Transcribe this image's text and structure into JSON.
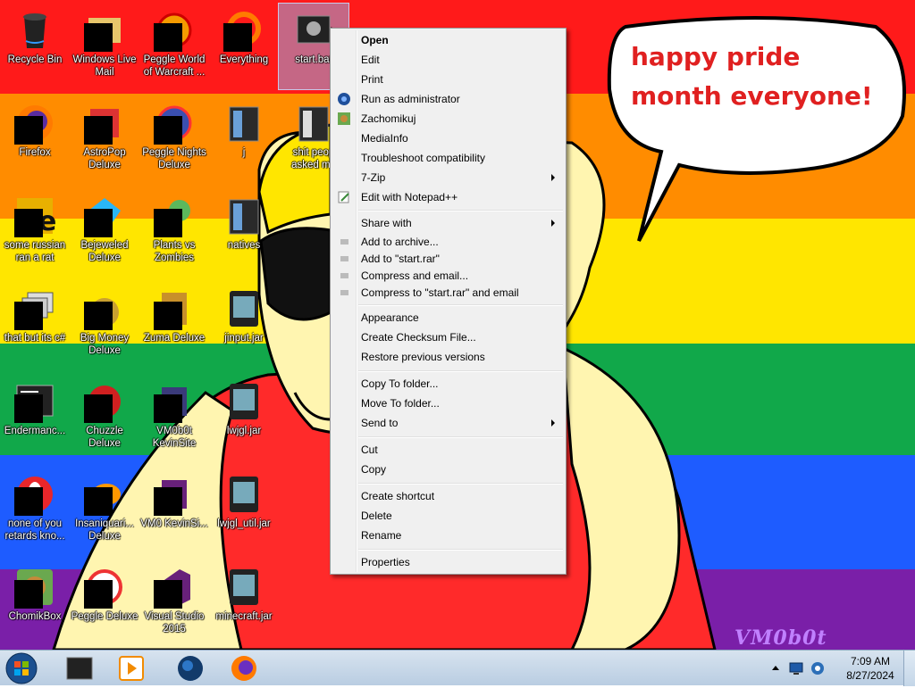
{
  "desktop": {
    "icons": [
      {
        "label": "Recycle Bin"
      },
      {
        "label": "Windows Live Mail"
      },
      {
        "label": "Peggle World of Warcraft ..."
      },
      {
        "label": "Everything"
      },
      {
        "label": "start.bat"
      },
      {
        "label": "Firefox"
      },
      {
        "label": "AstroPop Deluxe"
      },
      {
        "label": "Peggle Nights Deluxe"
      },
      {
        "label": "j"
      },
      {
        "label": "shit peop asked me"
      },
      {
        "label": "some russian ran a rat"
      },
      {
        "label": "Bejeweled Deluxe"
      },
      {
        "label": "Plants vs Zombies"
      },
      {
        "label": "natives"
      },
      {
        "label": "that but its c#"
      },
      {
        "label": "Big Money Deluxe"
      },
      {
        "label": "Zuma Deluxe"
      },
      {
        "label": "jinput.jar"
      },
      {
        "label": "Endermanc..."
      },
      {
        "label": "Chuzzle Deluxe"
      },
      {
        "label": "VM0b0t KevinSite"
      },
      {
        "label": "lwjgl.jar"
      },
      {
        "label": "none of you retards kno..."
      },
      {
        "label": "Insaniquari... Deluxe"
      },
      {
        "label": "VM0 KevinSi..."
      },
      {
        "label": "lwjgl_util.jar"
      },
      {
        "label": "ChomikBox"
      },
      {
        "label": "Peggle Deluxe"
      },
      {
        "label": "Visual Studio 2015"
      },
      {
        "label": "minecraft.jar"
      }
    ]
  },
  "wallpaper": {
    "bubble_text": "happy pride month everyone!",
    "signature": "VM0b0t",
    "stripe_colors": [
      "#ff1a1a",
      "#ff8c00",
      "#ffe600",
      "#11a84a",
      "#1e5cff",
      "#7a1fa8"
    ]
  },
  "context_menu": {
    "items": [
      {
        "label": "Open"
      },
      {
        "label": "Edit"
      },
      {
        "label": "Print"
      },
      {
        "label": "Run as administrator"
      },
      {
        "label": "Zachomikuj"
      },
      {
        "label": "MediaInfo"
      },
      {
        "label": "Troubleshoot compatibility"
      },
      {
        "label": "7-Zip"
      },
      {
        "label": "Edit with Notepad++"
      },
      {
        "label": "Share with"
      },
      {
        "label": "Add to archive..."
      },
      {
        "label": "Add to \"start.rar\""
      },
      {
        "label": "Compress and email..."
      },
      {
        "label": "Compress to \"start.rar\" and email"
      },
      {
        "label": "Appearance"
      },
      {
        "label": "Create Checksum File..."
      },
      {
        "label": "Restore previous versions"
      },
      {
        "label": "Copy To folder..."
      },
      {
        "label": "Move To folder..."
      },
      {
        "label": "Send to"
      },
      {
        "label": "Cut"
      },
      {
        "label": "Copy"
      },
      {
        "label": "Create shortcut"
      },
      {
        "label": "Delete"
      },
      {
        "label": "Rename"
      },
      {
        "label": "Properties"
      }
    ]
  },
  "taskbar": {
    "pinned": [
      "cmd-icon",
      "media-player-icon",
      "globe-icon",
      "firefox-icon"
    ],
    "clock": {
      "time": "7:09 AM",
      "date": "8/27/2024"
    }
  }
}
